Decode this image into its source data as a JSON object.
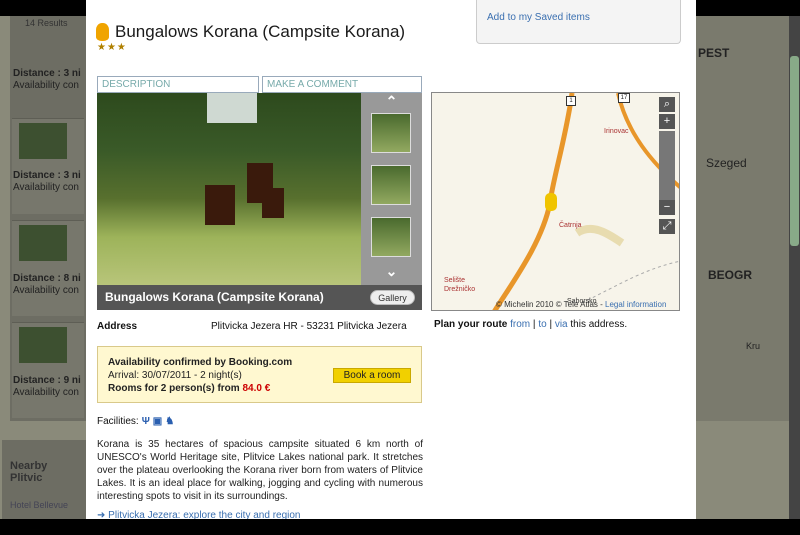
{
  "background": {
    "results_count": "14 Results",
    "items": [
      {
        "distance_label": "Distance : 3 ni",
        "availability": "Availability con"
      },
      {
        "distance_label": "Distance : 3 ni",
        "availability": "Availability con"
      },
      {
        "distance_label": "Distance : 8 ni",
        "availability": "Availability con"
      },
      {
        "distance_label": "Distance : 9 ni",
        "availability": "Availability con"
      }
    ],
    "nearby_title": "Nearby Plitvic",
    "nearby_link": "Hotel Bellevue",
    "map_labels": [
      "PEST",
      "Szeged",
      "BEOGR",
      "Kru"
    ]
  },
  "modal": {
    "save_link": "Add to my Saved items",
    "title": "Bungalows Korana (Campsite Korana)",
    "stars": "★★★",
    "tabs": {
      "description": "DESCRIPTION",
      "comment": "MAKE A COMMENT"
    },
    "photo_caption": "Bungalows Korana (Campsite Korana)",
    "gallery_button": "Gallery",
    "map": {
      "labels": [
        "Irinovac",
        "Čatrnja",
        "Selište Drežničko",
        "Saborsko"
      ],
      "copyright": "© Michelin 2010 © Tele Atlas - ",
      "legal": "Legal information",
      "road_numbers": [
        "1",
        "17"
      ]
    },
    "address_label": "Address",
    "address_value": "Plitvicka Jezera HR - 53231 Plitvicka Jezera",
    "route": {
      "prefix": "Plan your route",
      "from": "from",
      "sep1": "|",
      "to": "to",
      "sep2": "|",
      "via": "via",
      "suffix": "this address."
    },
    "availability": {
      "title": "Availability confirmed by Booking.com",
      "arrival": "Arrival: 30/07/2011 - 2 night(s)",
      "rooms": "Rooms for 2 person(s) from",
      "price": "84.0 €",
      "book_button": "Book a room"
    },
    "facilities_label": "Facilities:",
    "description": "Korana is 35 hectares of spacious campsite situated 6 km north of UNESCO's World Heritage site, Plitvice Lakes national park. It stretches over the plateau overlooking the Korana river born from waters of Plitvice Lakes. It is an ideal place for walking, jogging and cycling with numerous interesting spots to visit in its surroundings.",
    "explore_link": "Plitvicka Jezera: explore the city and region"
  }
}
